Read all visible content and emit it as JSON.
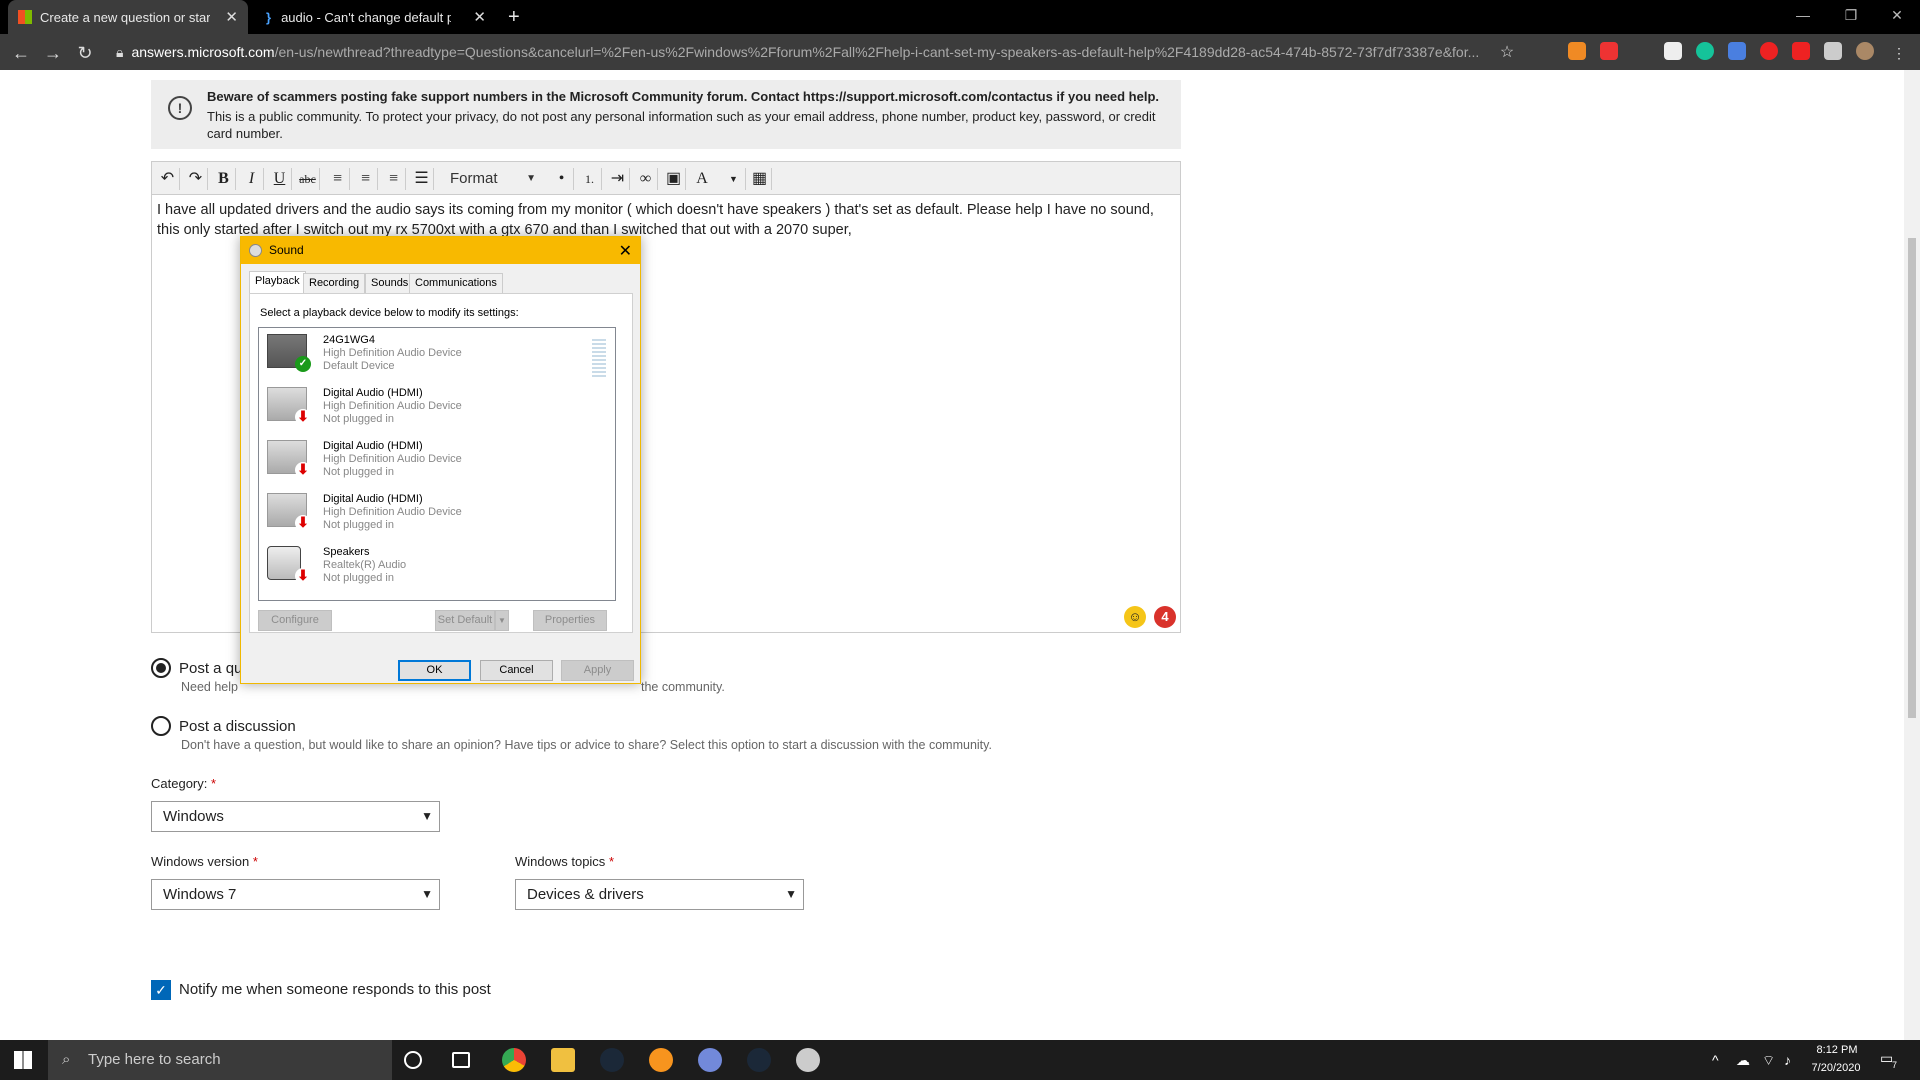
{
  "browser": {
    "tabs": [
      {
        "title": "Create a new question or start a",
        "active": true
      },
      {
        "title": "audio - Can't change default pla",
        "active": false
      }
    ],
    "url_host": "answers.microsoft.com",
    "url_rest": "/en-us/newthread?threadtype=Questions&cancelurl=%2Fen-us%2Fwindows%2Fforum%2Fall%2Fhelp-i-cant-set-my-speakers-as-default-help%2F4189dd28-ac54-474b-8572-73f7df73387e&for..."
  },
  "notice": {
    "bold": "Beware of scammers posting fake support numbers in the Microsoft Community forum. Contact https://support.microsoft.com/contactus if you need help.",
    "text": "This is a public community. To protect your privacy, do not post any personal information such as your email address, phone number, product key, password, or credit card number."
  },
  "editor": {
    "format_label": "Format",
    "body": "I have all updated drivers and the audio says its coming from my monitor ( which doesn't have speakers ) that's set as default. Please help I have no sound, this only started after I switch out my rx 5700xt with a gtx 670 and than I switched that out with a 2070 super,",
    "badge_count": "4"
  },
  "post_options": [
    {
      "label": "Post a qu",
      "desc": "Need help",
      "desc_tail": "the community.",
      "selected": true
    },
    {
      "label": "Post a discussion",
      "desc": "Don't have a question, but would like to share an opinion? Have tips or advice to share? Select this option to start a discussion with the community.",
      "selected": false
    }
  ],
  "category": {
    "label": "Category:",
    "value": "Windows"
  },
  "windows_version": {
    "label": "Windows version",
    "value": "Windows 7"
  },
  "windows_topics": {
    "label": "Windows topics",
    "value": "Devices & drivers"
  },
  "notify": {
    "label": "Notify me when someone responds to this post",
    "checked": true
  },
  "required_mark": "*",
  "dialog": {
    "title": "Sound",
    "tabs": [
      "Playback",
      "Recording",
      "Sounds",
      "Communications"
    ],
    "instruction": "Select a playback device below to modify its settings:",
    "devices": [
      {
        "name": "24G1WG4",
        "driver": "High Definition Audio Device",
        "status": "Default Device"
      },
      {
        "name": "Digital Audio (HDMI)",
        "driver": "High Definition Audio Device",
        "status": "Not plugged in"
      },
      {
        "name": "Digital Audio (HDMI)",
        "driver": "High Definition Audio Device",
        "status": "Not plugged in"
      },
      {
        "name": "Digital Audio (HDMI)",
        "driver": "High Definition Audio Device",
        "status": "Not plugged in"
      },
      {
        "name": "Speakers",
        "driver": "Realtek(R) Audio",
        "status": "Not plugged in"
      }
    ],
    "buttons": {
      "configure": "Configure",
      "set_default": "Set Default",
      "properties": "Properties",
      "ok": "OK",
      "cancel": "Cancel",
      "apply": "Apply"
    }
  },
  "taskbar": {
    "search_placeholder": "Type here to search",
    "time": "8:12 PM",
    "date": "7/20/2020",
    "notif_count": "7"
  },
  "colors": {
    "dialog_title": "#f8b900",
    "checkbox": "#0067b8",
    "badge_red": "#d9322b"
  }
}
